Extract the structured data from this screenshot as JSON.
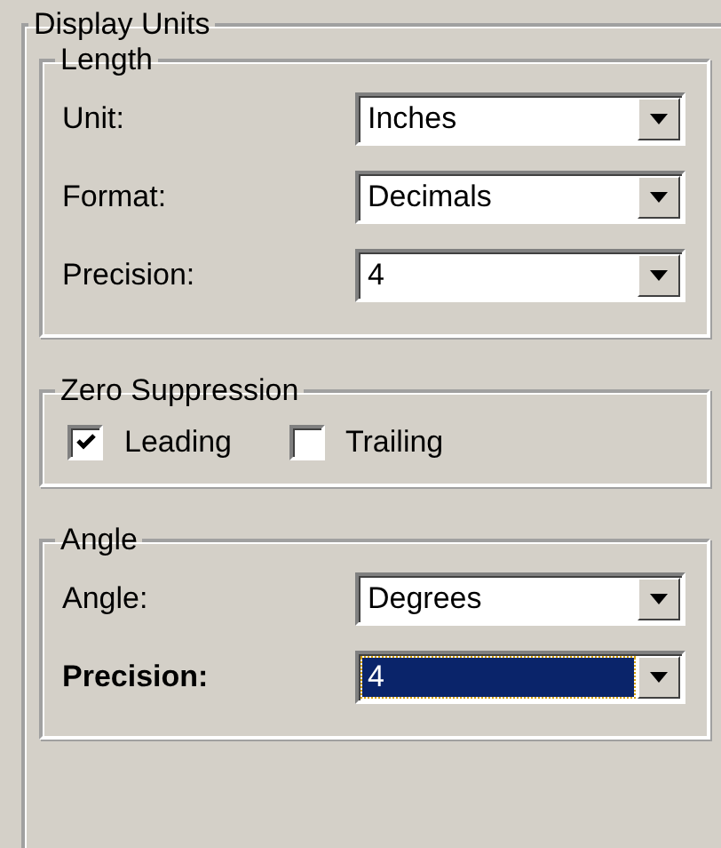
{
  "title": "Display Units",
  "groups": [
    {
      "kind": "fields",
      "title": "Length",
      "fields": [
        {
          "label": "Unit:",
          "value": "Inches",
          "focused": false
        },
        {
          "label": "Format:",
          "value": "Decimals",
          "focused": false
        },
        {
          "label": "Precision:",
          "value": "4",
          "focused": false
        }
      ]
    },
    {
      "kind": "checkboxes",
      "title": "Zero Suppression",
      "checkboxes": [
        {
          "label": "Leading",
          "checked": true
        },
        {
          "label": "Trailing",
          "checked": false
        }
      ]
    },
    {
      "kind": "fields",
      "title": "Angle",
      "fields": [
        {
          "label": "Angle:",
          "value": "Degrees",
          "focused": false
        },
        {
          "label": "Precision:",
          "value": "4",
          "focused": true
        }
      ]
    }
  ]
}
